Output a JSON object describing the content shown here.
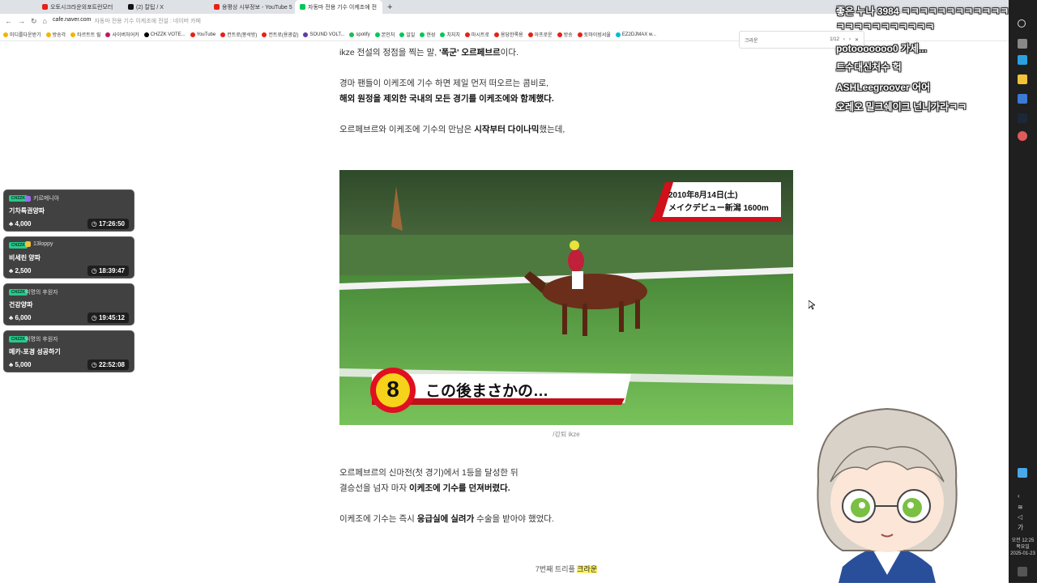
{
  "browser": {
    "tabs": [
      {
        "label": "오토시크라운외포트런모터",
        "fav_color": "#e62117"
      },
      {
        "label": "(2) 칼팁 / X",
        "fav_color": "#111111"
      },
      {
        "label": "용평상 시부정보 - YouTube 5",
        "fav_color": "#e62117"
      },
      {
        "label": "자동마 전용 기수 이케조에 전",
        "fav_color": "#03c75a"
      }
    ],
    "new_tab": "+",
    "url": "cafe.naver.com",
    "page_title": "자동마 전용 기수 이케조에 전설 : 네이버 카페",
    "bookmarks": [
      {
        "label": "미디를다운받기",
        "color": "#f4b400"
      },
      {
        "label": "방송각",
        "color": "#f4b400"
      },
      {
        "label": "타르트트 릴",
        "color": "#f4b400"
      },
      {
        "label": "사이버처어카",
        "color": "#c2185b"
      },
      {
        "label": "CHZZK VOTE...",
        "color": "#000000"
      },
      {
        "label": "YouTube",
        "color": "#e62117"
      },
      {
        "label": "컨트로(봉석방)",
        "color": "#e62117"
      },
      {
        "label": "컨트로(용광갈)",
        "color": "#e62117"
      },
      {
        "label": "SOUND VOLT...",
        "color": "#5c3ea3"
      },
      {
        "label": "spotify",
        "color": "#1db954"
      },
      {
        "label": "본인처",
        "color": "#03c75a"
      },
      {
        "label": "일일",
        "color": "#03c75a"
      },
      {
        "label": "현성",
        "color": "#03c75a"
      },
      {
        "label": "치지치",
        "color": "#03c75a"
      },
      {
        "label": "마시트로",
        "color": "#e62117"
      },
      {
        "label": "용당한록용",
        "color": "#e62117"
      },
      {
        "label": "아프로운",
        "color": "#e62117"
      },
      {
        "label": "방송",
        "color": "#e62117"
      },
      {
        "label": "토마이빙서울",
        "color": "#e62117"
      },
      {
        "label": "EZ2DJMAX w...",
        "color": "#00bcd4"
      },
      {
        "label": "기타 북마크",
        "color": "#f4b400"
      }
    ],
    "find": {
      "query": "크라운",
      "count": "1/12"
    }
  },
  "article": {
    "p1": "ikze 전설의 정점을 찍는 말, ",
    "p1_bold": "'폭군' 오르페브르",
    "p1_end": "이다.",
    "p2_line1": "경마 팬들이 이케조에 기수 하면 제일 먼저 떠오르는 콤비로,",
    "p2_line2": "해외 원정을 제외한 국내의 모든 경기를 이케조에와 함께했다.",
    "p3": "오르페브르와 이케조에 기수의 만남은 ",
    "p3_bold": "시작부터 다이나믹",
    "p3_end": "했는데,",
    "video": {
      "date_line": "2010年8月14日(土)",
      "race_line": "メイクデビュー新潟 1600m",
      "number": "8",
      "subtitle": "この後まさかの…"
    },
    "caption": "/강퇴 ikze",
    "p4_line1": "오르페브르의 신마전(첫 경기)에서 1등을 달성한 뒤",
    "p4_line2a": "결승선을 넘자 마자 ",
    "p4_line2b": "이케조에 기수를 던져버렸다.",
    "p5a": "이케조에 기수는 즉시 ",
    "p5b": "응급실에 실려가",
    "p5c": " 수술을 받아야 했었다.",
    "bottom_a": "7번째 트리플 ",
    "bottom_b": "크라운"
  },
  "donations": [
    {
      "badge": "CHZZK",
      "user": "키르메니아",
      "title": "기차특권양파",
      "amount": "4,000",
      "timer": "17:26:50"
    },
    {
      "badge": "CHZZK",
      "user": "13loppy",
      "title": "비세린 양파",
      "amount": "2,500",
      "timer": "18:39:47"
    },
    {
      "badge": "CHZZK",
      "user": "익명의 후원자",
      "title": "건강양파",
      "amount": "6,000",
      "timer": "19:45:12"
    },
    {
      "badge": "CHZZK",
      "user": "익명의 후원자",
      "title": "메카-포경 성공하기",
      "amount": "5,000",
      "timer": "22:52:08"
    }
  ],
  "chat": [
    {
      "text": "좋은 누나 3984 ㅋㅋㅋㅋㅋㅋㅋㅋㅋㅋㅋㅋ"
    },
    {
      "text": "ㅋㅋㅋㅋㅋㅋㅋㅋㅋㅋㅋ"
    },
    {
      "text": "potooooooo0 가세..."
    },
    {
      "text": "트수대신처수 헉"
    },
    {
      "text": "ASHLeegroover 어어"
    },
    {
      "text": "오레오 밀크쉐이크 넌니가라ㅋㅋ"
    }
  ],
  "taskbar": {
    "clock_line1": "오전 12:25",
    "clock_line2": "목요일",
    "clock_line3": "2025-01-23"
  }
}
